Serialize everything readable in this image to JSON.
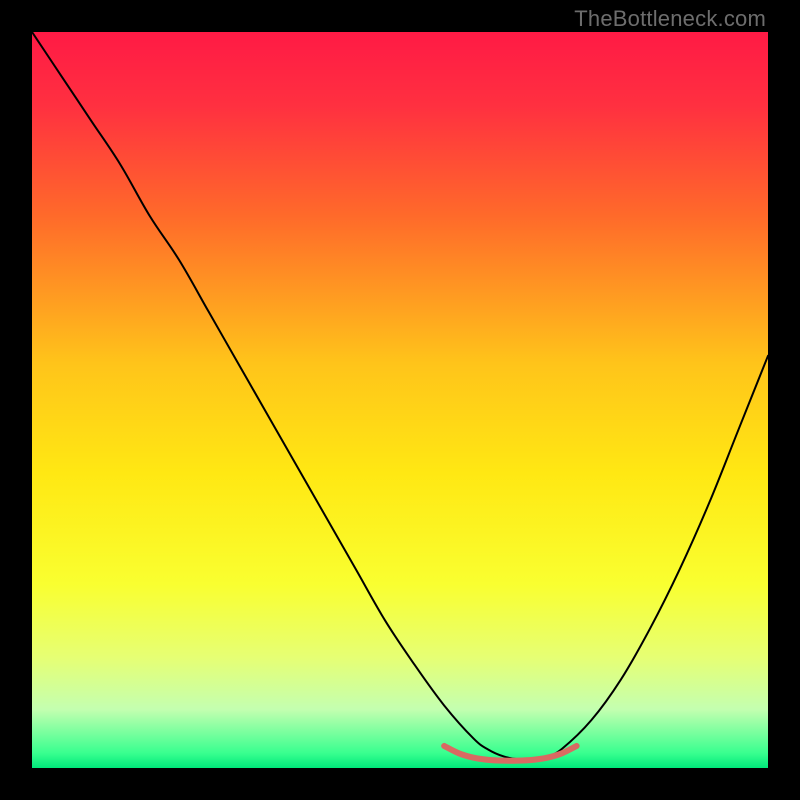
{
  "watermark": "TheBottleneck.com",
  "chart_data": {
    "type": "line",
    "title": "",
    "xlabel": "",
    "ylabel": "",
    "xlim": [
      0,
      100
    ],
    "ylim": [
      0,
      100
    ],
    "grid": false,
    "legend": false,
    "background_gradient": [
      {
        "pos": 0.0,
        "color": "#ff1a45"
      },
      {
        "pos": 0.1,
        "color": "#ff3040"
      },
      {
        "pos": 0.25,
        "color": "#ff6a2a"
      },
      {
        "pos": 0.45,
        "color": "#ffc41a"
      },
      {
        "pos": 0.6,
        "color": "#ffe813"
      },
      {
        "pos": 0.75,
        "color": "#f9ff30"
      },
      {
        "pos": 0.85,
        "color": "#e6ff74"
      },
      {
        "pos": 0.92,
        "color": "#c4ffb0"
      },
      {
        "pos": 0.98,
        "color": "#38ff8f"
      },
      {
        "pos": 1.0,
        "color": "#00e87a"
      }
    ],
    "series": [
      {
        "name": "curve",
        "color": "#000000",
        "width": 2,
        "x": [
          0.0,
          4,
          8,
          12,
          16,
          20,
          24,
          28,
          32,
          36,
          40,
          44,
          48,
          52,
          56,
          60,
          62,
          64,
          66,
          68,
          70,
          72,
          76,
          80,
          84,
          88,
          92,
          96,
          100
        ],
        "y": [
          100,
          94,
          88,
          82,
          75,
          69,
          62,
          55,
          48,
          41,
          34,
          27,
          20,
          14,
          8.5,
          4.0,
          2.5,
          1.6,
          1.2,
          1.2,
          1.6,
          2.6,
          6.5,
          12,
          19,
          27,
          36,
          46,
          56
        ]
      },
      {
        "name": "marker-band",
        "color": "#d96a62",
        "width": 6,
        "x": [
          56,
          58,
          60,
          62,
          64,
          66,
          68,
          70,
          72,
          74
        ],
        "y": [
          3.0,
          2.0,
          1.4,
          1.1,
          1.0,
          1.0,
          1.1,
          1.4,
          2.0,
          3.0
        ]
      }
    ]
  }
}
